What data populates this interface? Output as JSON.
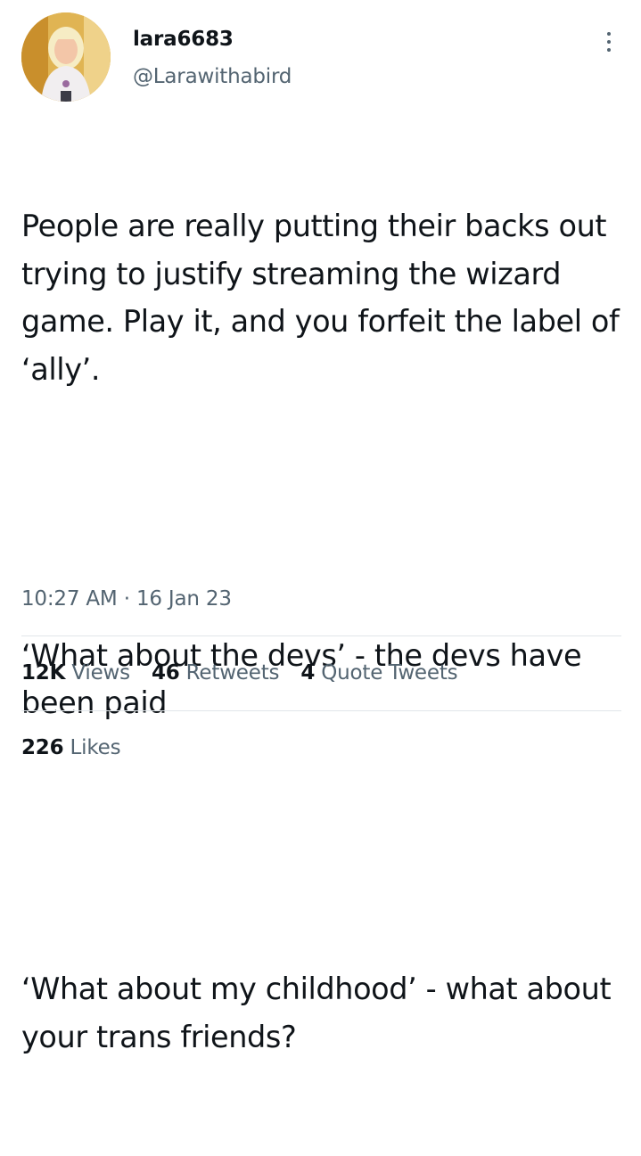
{
  "author": {
    "display_name": "lara6683",
    "handle": "@Larawithabird",
    "avatar_icon": "profile-photo"
  },
  "more_icon": "more-vertical-icon",
  "tweet": {
    "paragraphs": [
      "People are really putting their backs out trying to justify streaming the wizard game. Play it, and you forfeit the label of ‘ally’.",
      "‘What about the devs’ - the devs have been paid",
      "‘What about my childhood’ - what about your trans friends?"
    ]
  },
  "meta": {
    "time": "10:27 AM",
    "separator": "·",
    "date": "16 Jan 23"
  },
  "stats": {
    "views": {
      "count": "12K",
      "label": "Views"
    },
    "retweets": {
      "count": "46",
      "label": "Retweets"
    },
    "quote_tweets": {
      "count": "4",
      "label": "Quote Tweets"
    },
    "likes": {
      "count": "226",
      "label": "Likes"
    }
  },
  "colors": {
    "text_primary": "#0f1419",
    "text_secondary": "#536471",
    "divider": "#e1e6ea"
  }
}
